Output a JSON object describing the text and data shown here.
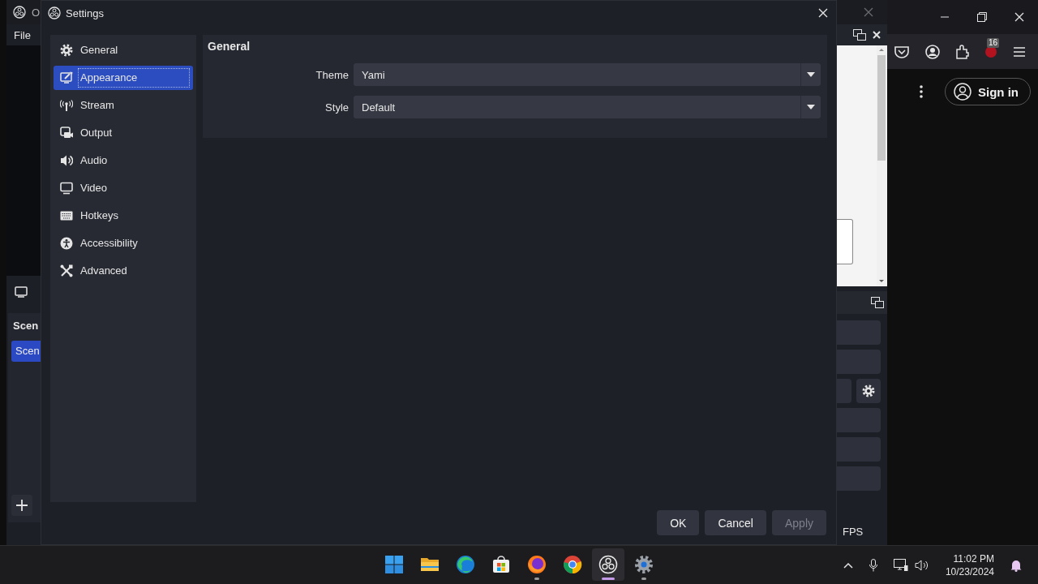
{
  "obs_window": {
    "title": "O",
    "menu": [
      "File"
    ],
    "scenes": {
      "heading": "Scen",
      "items": [
        {
          "label": "Scen",
          "selected": true
        }
      ]
    },
    "status": "FPS"
  },
  "browser": {
    "badge": "16",
    "sign_in": "Sign in"
  },
  "settings_dialog": {
    "title": "Settings",
    "sidebar": {
      "items": [
        {
          "label": "General",
          "kind": "gear",
          "selected": false
        },
        {
          "label": "Appearance",
          "kind": "appearance",
          "selected": true
        },
        {
          "label": "Stream",
          "kind": "stream",
          "selected": false
        },
        {
          "label": "Output",
          "kind": "output",
          "selected": false
        },
        {
          "label": "Audio",
          "kind": "audio",
          "selected": false
        },
        {
          "label": "Video",
          "kind": "video",
          "selected": false
        },
        {
          "label": "Hotkeys",
          "kind": "hotkeys",
          "selected": false
        },
        {
          "label": "Accessibility",
          "kind": "accessibility",
          "selected": false
        },
        {
          "label": "Advanced",
          "kind": "advanced",
          "selected": false
        }
      ]
    },
    "section": {
      "heading": "General",
      "fields": [
        {
          "label": "Theme",
          "value": "Yami"
        },
        {
          "label": "Style",
          "value": "Default"
        }
      ]
    },
    "buttons": [
      {
        "label": "OK",
        "disabled": false
      },
      {
        "label": "Cancel",
        "disabled": false
      },
      {
        "label": "Apply",
        "disabled": true
      }
    ]
  },
  "taskbar": {
    "apps": [
      {
        "kind": "start",
        "running": false,
        "active": false
      },
      {
        "kind": "folder",
        "running": false,
        "active": false
      },
      {
        "kind": "edge",
        "running": false,
        "active": false
      },
      {
        "kind": "store",
        "running": false,
        "active": false
      },
      {
        "kind": "firefox",
        "running": true,
        "active": false
      },
      {
        "kind": "chrome",
        "running": false,
        "active": false
      },
      {
        "kind": "obs",
        "running": true,
        "active": true
      },
      {
        "kind": "settings",
        "running": true,
        "active": false
      }
    ],
    "time": "11:02 PM",
    "date": "10/23/2024"
  }
}
